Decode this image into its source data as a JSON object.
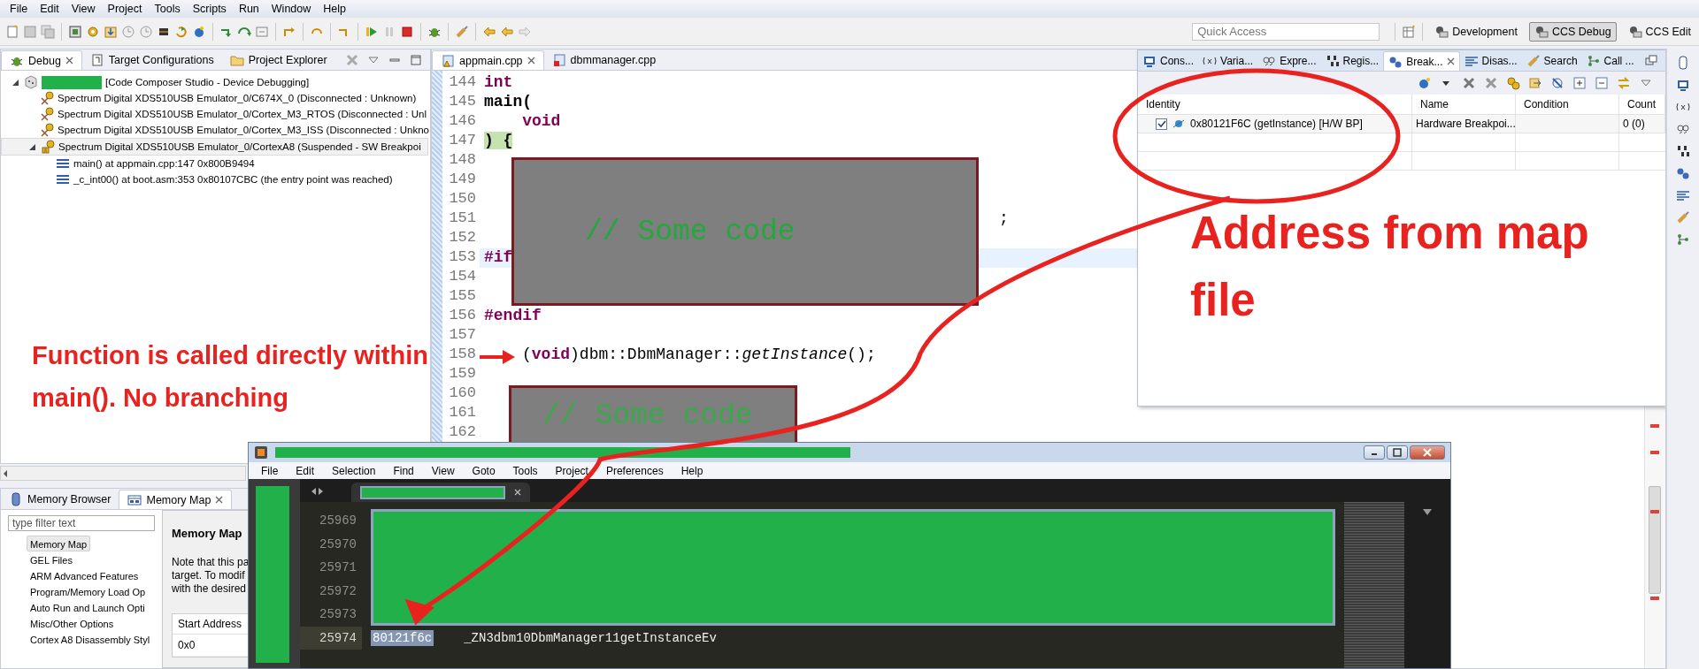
{
  "menu_bar": {
    "items": [
      "File",
      "Edit",
      "View",
      "Project",
      "Tools",
      "Scripts",
      "Run",
      "Window",
      "Help"
    ]
  },
  "quick_access": {
    "placeholder": "Quick Access"
  },
  "perspectives": [
    {
      "label": "Development",
      "selected": false
    },
    {
      "label": "CCS Debug",
      "selected": true
    },
    {
      "label": "CCS Edit",
      "selected": false
    }
  ],
  "debug_view": {
    "tabs": [
      {
        "label": "Debug",
        "selected": true,
        "kind": "debug"
      },
      {
        "label": "Target Configurations",
        "selected": false,
        "kind": "target"
      },
      {
        "label": "Project Explorer",
        "selected": false,
        "kind": "project"
      }
    ],
    "tree": [
      {
        "label": "[Code Composer Studio - Device Debugging]",
        "kind": "launch",
        "redacted": true,
        "expanded": true,
        "selected": false,
        "children": [
          {
            "label": "Spectrum Digital XDS510USB Emulator_0/C674X_0 (Disconnected : Unknown)",
            "kind": "disconnected",
            "selected": false
          },
          {
            "label": "Spectrum Digital XDS510USB Emulator_0/Cortex_M3_RTOS (Disconnected : Unl",
            "kind": "disconnected",
            "selected": false
          },
          {
            "label": "Spectrum Digital XDS510USB Emulator_0/Cortex_M3_ISS (Disconnected : Unkno",
            "kind": "disconnected",
            "selected": false
          },
          {
            "label": "Spectrum Digital XDS510USB Emulator_0/CortexA8 (Suspended - SW Breakpoi",
            "kind": "suspended",
            "expanded": true,
            "selected": true,
            "children": [
              {
                "label": "main() at appmain.cpp:147 0x800B9494",
                "kind": "frame",
                "selected": false
              },
              {
                "label": "_c_int00() at boot.asm:353 0x80107CBC  (the entry point was reached)",
                "kind": "frame",
                "selected": false
              }
            ]
          }
        ]
      }
    ]
  },
  "editor": {
    "tabs": [
      {
        "label": "appmain.cpp",
        "selected": true,
        "kind": "warning"
      },
      {
        "label": "dbmmanager.cpp",
        "selected": false,
        "kind": "error"
      }
    ],
    "lines": [
      {
        "number": "144",
        "text": "int",
        "kind": "keyword",
        "current": false,
        "cursor": false
      },
      {
        "number": "145",
        "text": "main(",
        "kind": "bold",
        "current": false,
        "cursor": false
      },
      {
        "number": "146",
        "text": "    void",
        "kind": "keyword",
        "current": false,
        "cursor": false
      },
      {
        "number": "147",
        "text": ") {",
        "kind": "bold",
        "current": true,
        "cursor": false
      },
      {
        "number": "148"
      },
      {
        "number": "149"
      },
      {
        "number": "150"
      },
      {
        "number": "151",
        "text": ";",
        "kind": "tail",
        "current": false,
        "cursor": false
      },
      {
        "number": "152"
      },
      {
        "number": "153",
        "text": "#if",
        "kind": "keyword",
        "current": false,
        "cursor": true
      },
      {
        "number": "154"
      },
      {
        "number": "155"
      },
      {
        "number": "156",
        "text": "#endif",
        "kind": "keyword",
        "current": false,
        "cursor": false
      },
      {
        "number": "157"
      },
      {
        "number": "158",
        "text": "(**void**)dbm::DbmManager::*getInstance*();",
        "kind": "call",
        "current": false,
        "cursor": false
      },
      {
        "number": "159"
      },
      {
        "number": "160"
      },
      {
        "number": "161"
      },
      {
        "number": "162"
      }
    ],
    "code_masks": [
      {
        "text": "// Some code"
      },
      {
        "text": "// Some code"
      }
    ]
  },
  "breakpoints_view": {
    "tabs": [
      {
        "label": "Cons...",
        "selected": false,
        "kind": "console"
      },
      {
        "label": "Varia...",
        "selected": false,
        "kind": "variables"
      },
      {
        "label": "Expre...",
        "selected": false,
        "kind": "expressions"
      },
      {
        "label": "Regis...",
        "selected": false,
        "kind": "registers"
      },
      {
        "label": "Break...",
        "selected": true,
        "kind": "breakpoints"
      },
      {
        "label": "Disas...",
        "selected": false,
        "kind": "disassembly"
      },
      {
        "label": "Search",
        "selected": false,
        "kind": "search"
      },
      {
        "label": "Call ...",
        "selected": false,
        "kind": "call"
      }
    ],
    "columns": [
      "Identity",
      "Name",
      "Condition",
      "Count"
    ],
    "rows": [
      {
        "identity": "0x80121F6C (getInstance)  [H/W BP]",
        "name": "Hardware Breakpoi...",
        "count": "0 (0)",
        "checked": true
      }
    ]
  },
  "memory_view": {
    "tabs": [
      {
        "label": "Memory Browser",
        "selected": false,
        "kind": "browser"
      },
      {
        "label": "Memory Map",
        "selected": true,
        "kind": "map"
      }
    ],
    "filter": {
      "placeholder": "type filter text"
    },
    "categories": [
      {
        "label": "Memory Map",
        "selected": true
      },
      {
        "label": "GEL Files",
        "selected": false
      },
      {
        "label": "ARM Advanced Features",
        "selected": false
      },
      {
        "label": "Program/Memory Load Op",
        "selected": false
      },
      {
        "label": "Auto Run and Launch Opti",
        "selected": false
      },
      {
        "label": "Misc/Other Options",
        "selected": false
      },
      {
        "label": "Cortex A8 Disassembly Styl",
        "selected": false
      }
    ],
    "page": {
      "title": "Memory Map",
      "note_lines": [
        "Note that this pa",
        "target.  To modif",
        "with the desired"
      ],
      "table": {
        "columns": [
          "Start Address"
        ],
        "rows": [
          [
            "0x0"
          ]
        ]
      }
    }
  },
  "map_window": {
    "menu": [
      "File",
      "Edit",
      "Selection",
      "Find",
      "View",
      "Goto",
      "Tools",
      "Project",
      "Preferences",
      "Help"
    ],
    "lines": [
      {
        "number": "25969",
        "selected": false
      },
      {
        "number": "25970",
        "selected": false
      },
      {
        "number": "25971",
        "selected": false
      },
      {
        "number": "25972",
        "selected": false
      },
      {
        "number": "25973",
        "selected": false
      },
      {
        "number": "25974",
        "address": "80121f6c",
        "symbol": "_ZN3dbm10DbmManager11getInstanceEv",
        "selected": true
      }
    ]
  },
  "annotations": [
    {
      "text": "Function is called directly within main(). No branching",
      "kind": "left"
    },
    {
      "text": "Address from map file",
      "kind": "right"
    }
  ]
}
